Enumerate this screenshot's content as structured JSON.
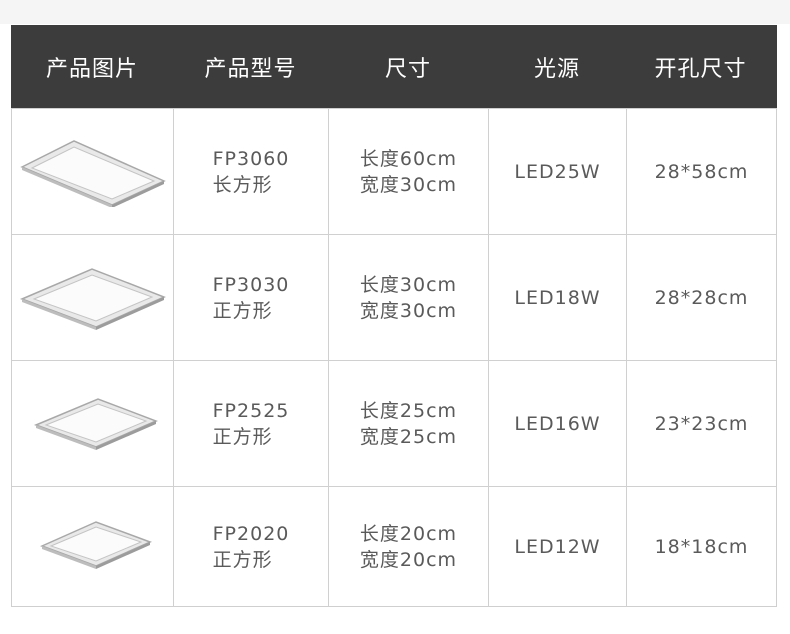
{
  "header": [
    "产品图片",
    "产品型号",
    "尺寸",
    "光源",
    "开孔尺寸"
  ],
  "rows": [
    {
      "image": "rectangular-panel-icon",
      "model": "FP3060",
      "shape": "长方形",
      "length": "长度60cm",
      "width": "宽度30cm",
      "light": "LED25W",
      "cutout": "28*58cm"
    },
    {
      "image": "square-panel-icon",
      "model": "FP3030",
      "shape": "正方形",
      "length": "长度30cm",
      "width": "宽度30cm",
      "light": "LED18W",
      "cutout": "28*28cm"
    },
    {
      "image": "square-panel-icon",
      "model": "FP2525",
      "shape": "正方形",
      "length": "长度25cm",
      "width": "宽度25cm",
      "light": "LED16W",
      "cutout": "23*23cm"
    },
    {
      "image": "square-panel-icon",
      "model": "FP2020",
      "shape": "正方形",
      "length": "长度20cm",
      "width": "宽度20cm",
      "light": "LED12W",
      "cutout": "18*18cm"
    }
  ],
  "colors": {
    "header_bg": "#3c3c3c",
    "header_text": "#ffffff",
    "border": "#d0d0d0",
    "body_text": "#5a5a5a"
  }
}
